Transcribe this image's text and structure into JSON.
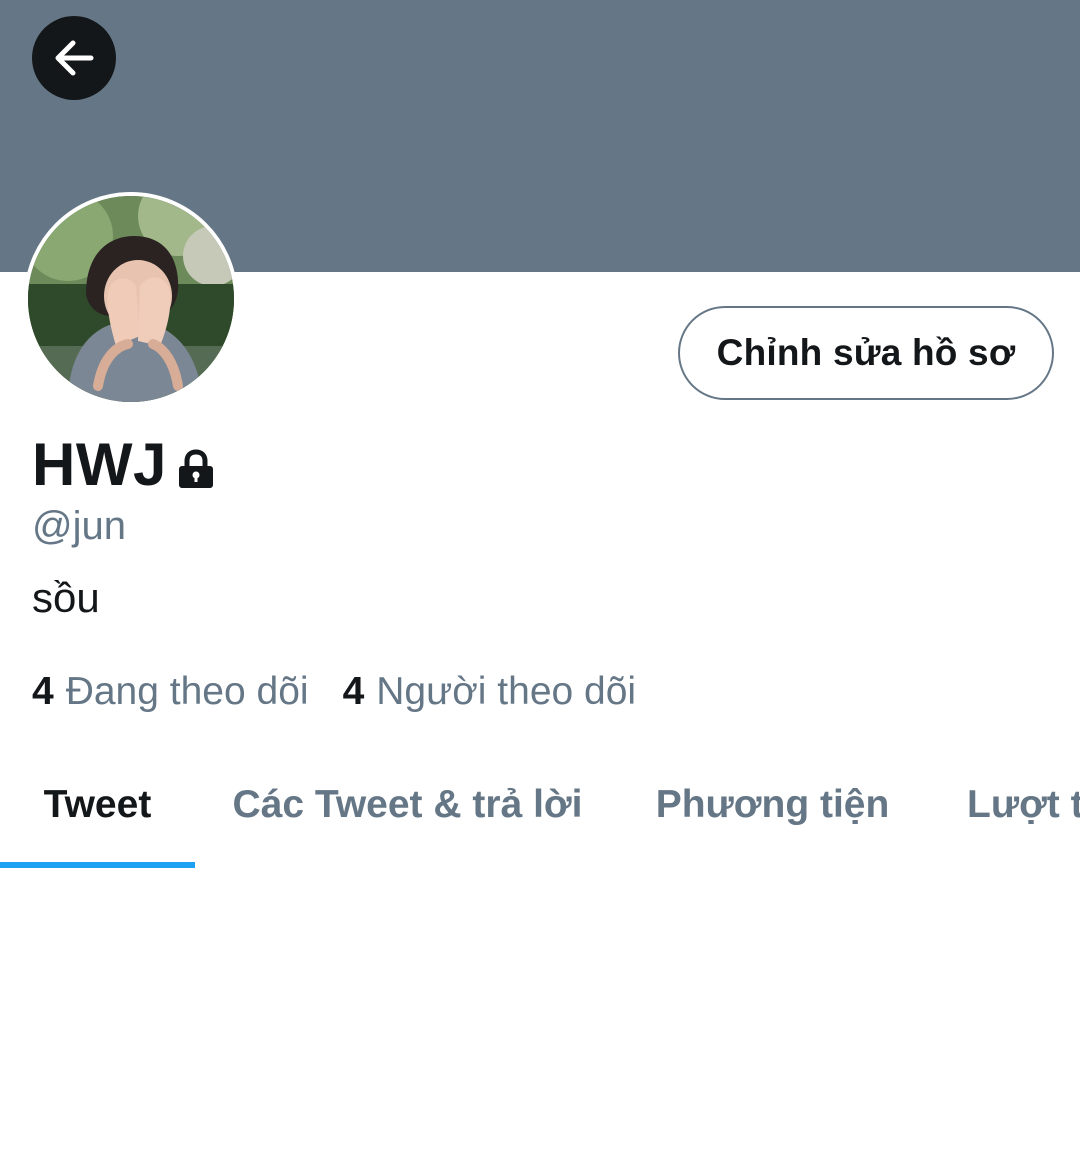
{
  "header": {
    "banner_color": "#657786",
    "back_icon": "arrow-left-icon"
  },
  "profile": {
    "avatar_icon": "avatar-photo",
    "edit_button_label": "Chỉnh sửa hồ sơ",
    "display_name": "HWJ",
    "protected_icon": "lock-icon",
    "handle": "@jun",
    "bio": "sồu",
    "following_count": "4",
    "following_label": "Đang theo dõi",
    "followers_count": "4",
    "followers_label": "Người theo dõi"
  },
  "tabs": [
    {
      "label": "Tweet",
      "active": true
    },
    {
      "label": "Các Tweet & trả lời",
      "active": false
    },
    {
      "label": "Phương tiện",
      "active": false
    },
    {
      "label": "Lượt thích",
      "active": false
    }
  ],
  "colors": {
    "accent": "#1da1f2",
    "text_primary": "#14171a",
    "text_secondary": "#657786"
  }
}
